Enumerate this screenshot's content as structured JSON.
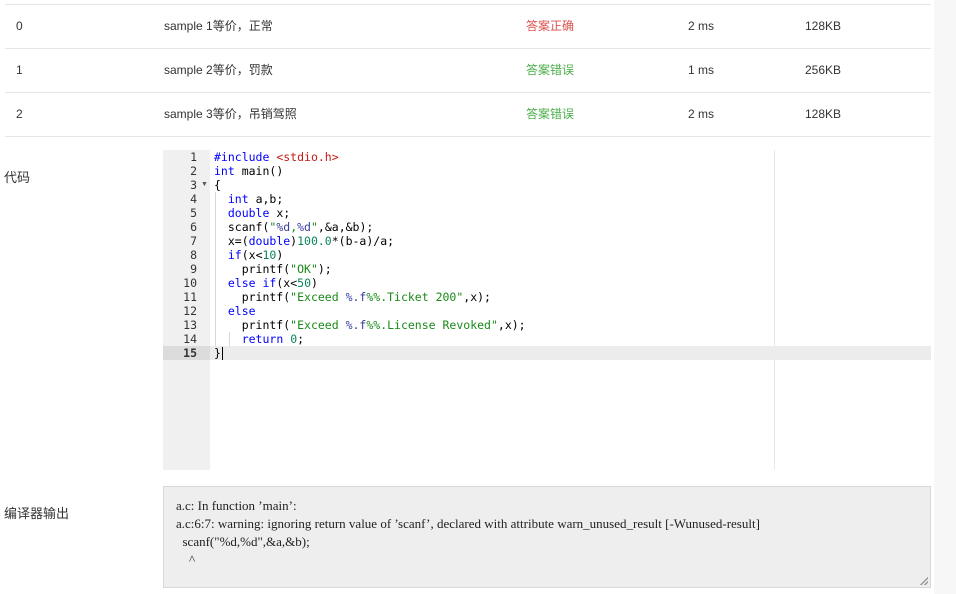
{
  "results": {
    "rows": [
      {
        "id": "0",
        "desc": "sample 1等价，正常",
        "status": "答案正确",
        "status_color": "#d9534f",
        "time": "2 ms",
        "memory": "128KB"
      },
      {
        "id": "1",
        "desc": "sample 2等价，罚款",
        "status": "答案错误",
        "status_color": "#4cae4c",
        "time": "1 ms",
        "memory": "256KB"
      },
      {
        "id": "2",
        "desc": "sample 3等价，吊销驾照",
        "status": "答案错误",
        "status_color": "#4cae4c",
        "time": "2 ms",
        "memory": "128KB"
      }
    ]
  },
  "code_section": {
    "label": "代码",
    "line_numbers": [
      "1",
      "2",
      "3",
      "4",
      "5",
      "6",
      "7",
      "8",
      "9",
      "10",
      "11",
      "12",
      "13",
      "14",
      "15"
    ],
    "fold_marker": "▼",
    "active_line": "15"
  },
  "compiler_section": {
    "label": "编译器输出",
    "output_lines": [
      "a.c: In function ’main’:",
      "a.c:6:7: warning: ignoring return value of ’scanf’, declared with attribute warn_unused_result [-Wunused-result]",
      "  scanf(\"%d,%d\",&a,&b);",
      "    ^"
    ]
  }
}
